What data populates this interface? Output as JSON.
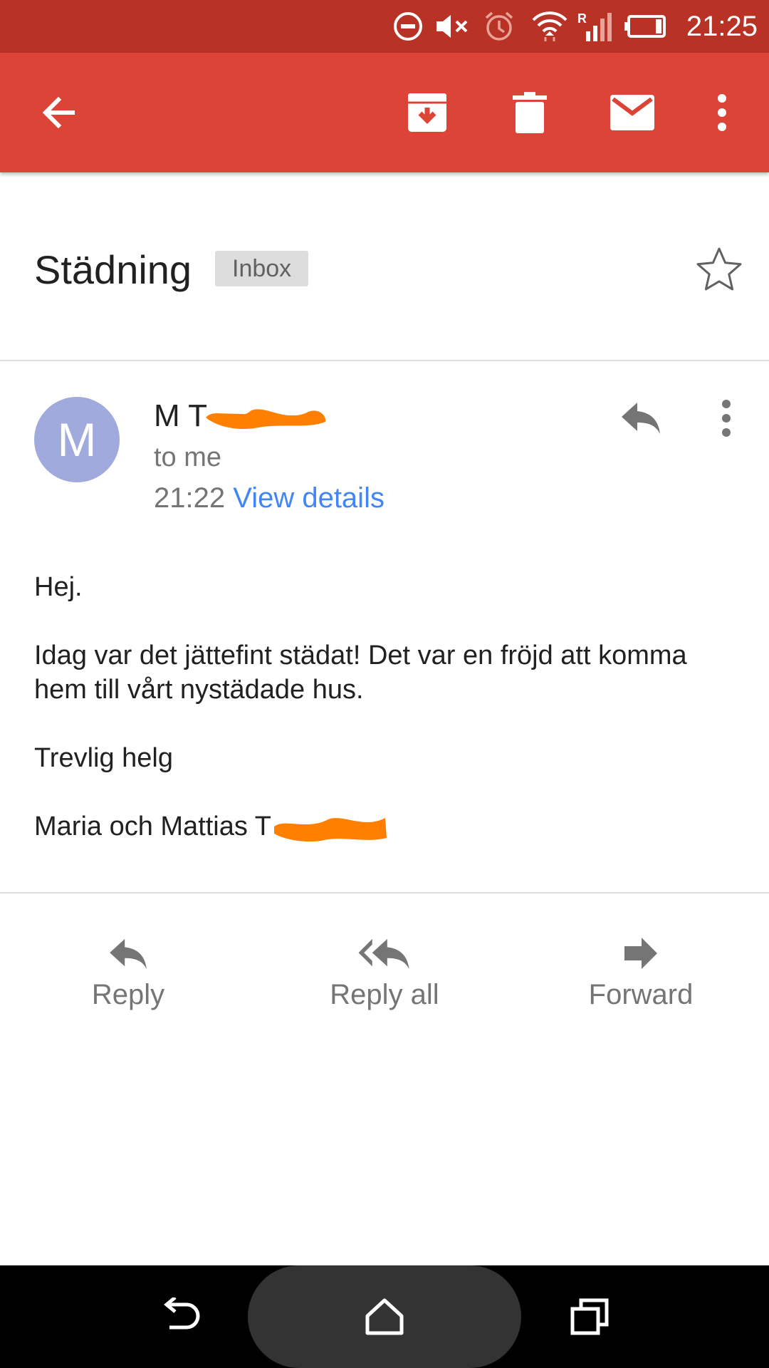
{
  "status_bar": {
    "time": "21:25",
    "icons": [
      "do-not-disturb-icon",
      "mute-icon",
      "alarm-icon",
      "wifi-icon",
      "signal-roaming-icon",
      "battery-icon"
    ]
  },
  "toolbar": {
    "back_icon": "arrow-back-icon",
    "actions": [
      "archive-icon",
      "delete-icon",
      "mark-unread-icon",
      "more-vert-icon"
    ]
  },
  "email": {
    "subject": "Städning",
    "label": "Inbox",
    "starred": false,
    "avatar_letter": "M",
    "avatar_color": "#a0aadc",
    "sender_name": "M T",
    "recipient": "to me",
    "time": "21:22",
    "view_details": "View details",
    "body": [
      "Hej.",
      "Idag var det jättefint städat! Det var en fröjd att komma hem till vårt nystädade hus.",
      "Trevlig helg",
      "Maria och Mattias T"
    ]
  },
  "actions": {
    "reply": "Reply",
    "reply_all": "Reply all",
    "forward": "Forward"
  },
  "colors": {
    "status_bar": "#b83226",
    "app_bar": "#db4437",
    "link": "#4285f4",
    "redaction": "#ff7f00"
  },
  "nav_bar": {
    "icons": [
      "back-nav-icon",
      "home-nav-icon",
      "recents-nav-icon"
    ]
  }
}
